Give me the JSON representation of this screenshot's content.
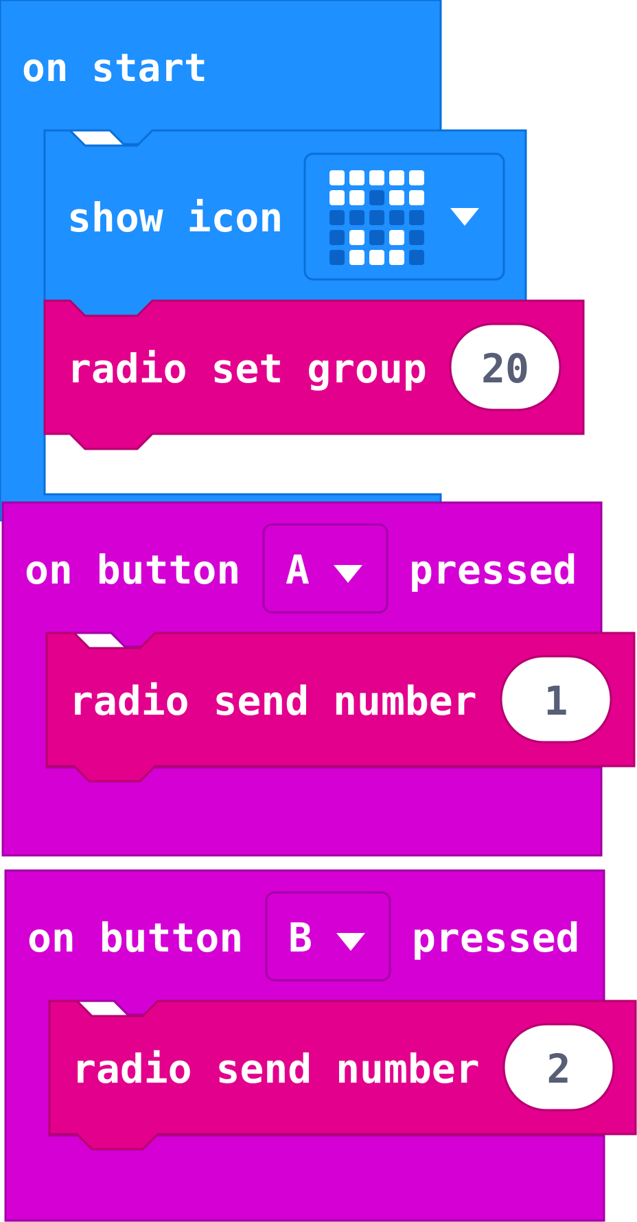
{
  "colors": {
    "basic": "#1e90ff",
    "basic_dark": "#0b6fd8",
    "radio": "#e3008c",
    "radio_dark": "#b4006f",
    "input": "#d400d4",
    "input_dark": "#a300a3",
    "text": "#ffffff",
    "number_text": "#575e75",
    "led_on": "#ffffff",
    "led_off": "#0b63c8"
  },
  "blocks": {
    "on_start": {
      "hat_label": "on start",
      "show_icon": {
        "label": "show icon",
        "icon_name": "heart-icon",
        "icon_grid": [
          [
            1,
            1,
            1,
            1,
            1
          ],
          [
            1,
            1,
            0,
            1,
            1
          ],
          [
            0,
            0,
            0,
            0,
            0
          ],
          [
            0,
            1,
            0,
            1,
            0
          ],
          [
            0,
            1,
            1,
            1,
            0
          ]
        ]
      },
      "radio_set_group": {
        "label": "radio set group",
        "value": "20"
      }
    },
    "on_button_a": {
      "label_prefix": "on button",
      "button": "A",
      "label_suffix": "pressed",
      "radio_send": {
        "label": "radio send number",
        "value": "1"
      }
    },
    "on_button_b": {
      "label_prefix": "on button",
      "button": "B",
      "label_suffix": "pressed",
      "radio_send": {
        "label": "radio send number",
        "value": "2"
      }
    }
  }
}
